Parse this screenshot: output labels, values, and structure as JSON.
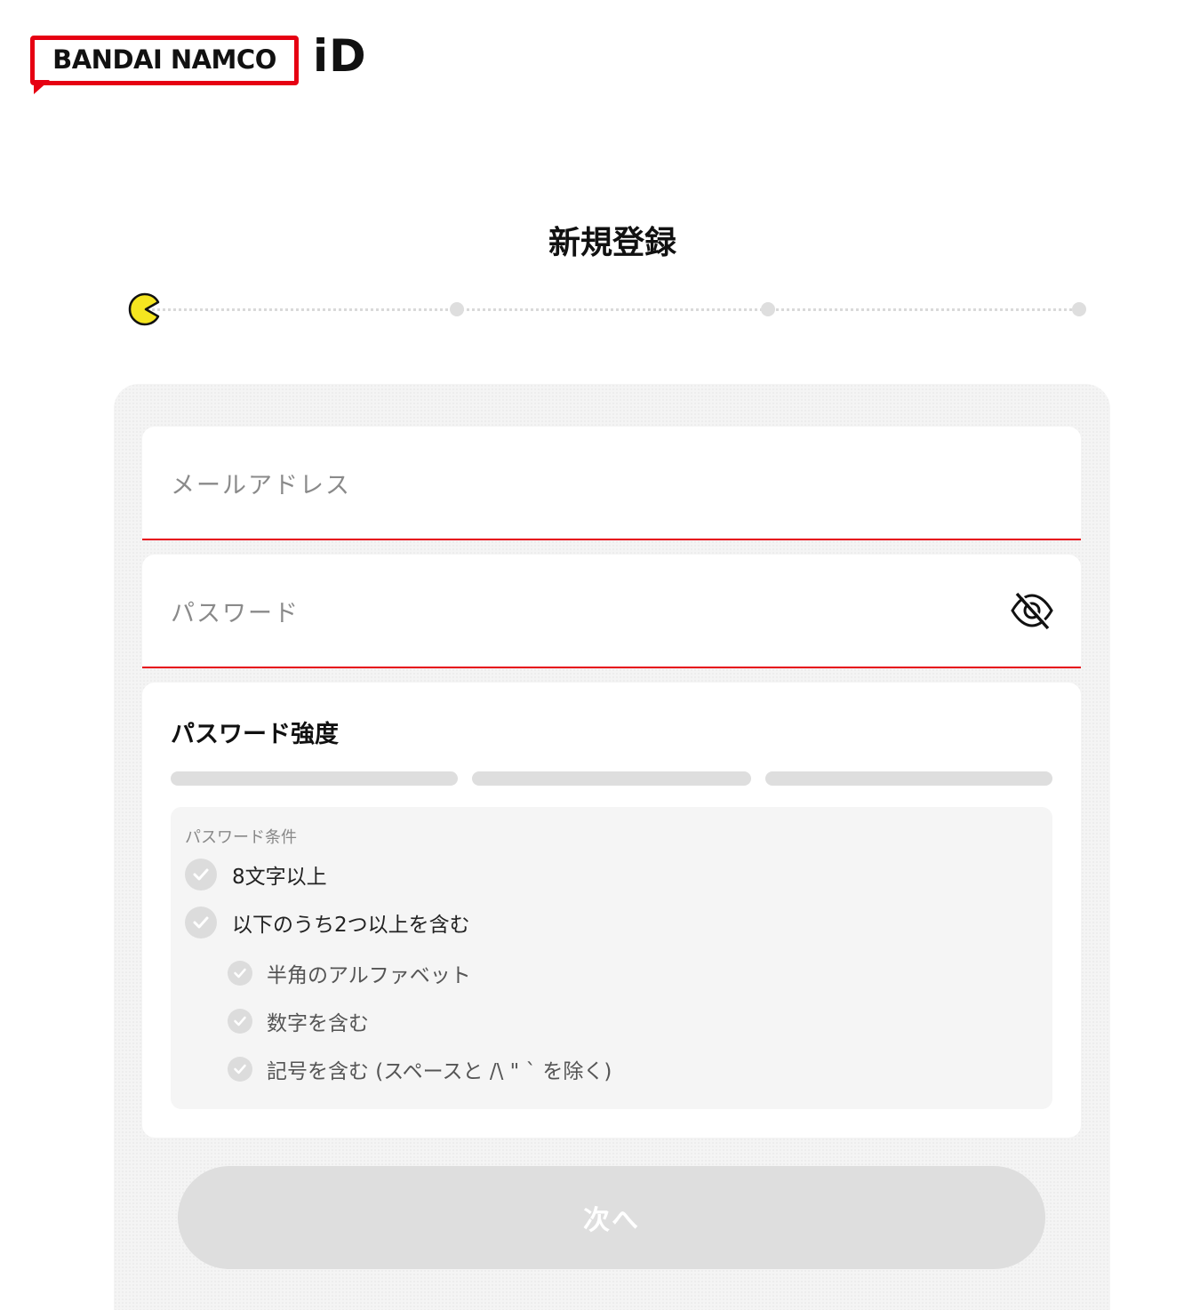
{
  "header": {
    "logo_text": "BANDAI NAMCO",
    "logo_suffix": "iD"
  },
  "page": {
    "title": "新規登録"
  },
  "stepper": {
    "total_steps": 4,
    "current_step": 1
  },
  "form": {
    "email_label": "メールアドレス",
    "password_label": "パスワード",
    "password_toggle_icon": "eye-slash-icon"
  },
  "strength": {
    "title": "パスワード強度",
    "level": 0,
    "segments": 3
  },
  "conditions": {
    "title": "パスワード条件",
    "items": [
      {
        "label": "8文字以上",
        "met": false
      },
      {
        "label": "以下のうち2つ以上を含む",
        "met": false
      },
      {
        "label": "半角のアルファベット",
        "met": false
      },
      {
        "label": "数字を含む",
        "met": false
      },
      {
        "label": "記号を含む (スペースと /\\ \" ` を除く)",
        "met": false
      }
    ]
  },
  "actions": {
    "next_label": "次へ"
  },
  "colors": {
    "brand_red": "#e60012",
    "pacman_yellow": "#f5e520",
    "disabled_gray": "#dedede"
  }
}
